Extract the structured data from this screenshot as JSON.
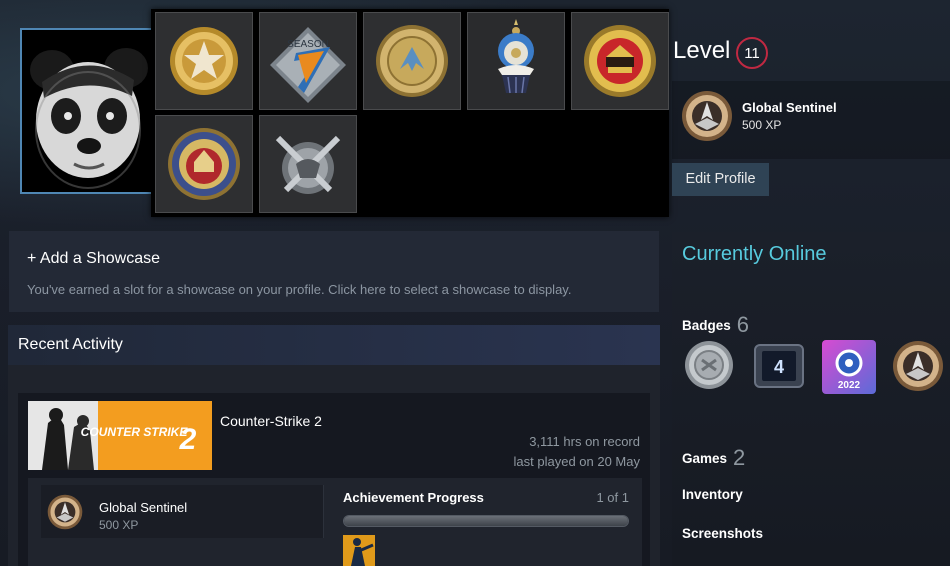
{
  "profile": {
    "level_label": "Level",
    "level": "11",
    "favorite_badge": {
      "name": "Global Sentinel",
      "xp": "500 XP",
      "icon": "cs-rank-badge-icon"
    },
    "edit_profile_label": "Edit Profile",
    "status": "Currently Online"
  },
  "pins_popup": {
    "pins": [
      {
        "name": "service-medal-pin",
        "icon": "gold-star-medal-icon"
      },
      {
        "name": "season-pin",
        "icon": "season-7-pin-icon",
        "text": "SEASON"
      },
      {
        "name": "antwerp-coin-pin",
        "icon": "gold-coin-icon"
      },
      {
        "name": "cupcake-pin",
        "icon": "cupcake-icon"
      },
      {
        "name": "major-coin-pin",
        "icon": "gold-red-coin-icon"
      },
      {
        "name": "stockholm-coin-pin",
        "icon": "stockholm-coin-icon"
      },
      {
        "name": "silver-weapons-pin",
        "icon": "silver-emblem-icon"
      }
    ]
  },
  "sidebar": {
    "badges_label": "Badges",
    "badges_count": "6",
    "badges": [
      {
        "name": "badge-silver-coin",
        "icon": "silver-coin-icon"
      },
      {
        "name": "badge-years-of-service",
        "icon": "years-service-icon",
        "text": "4"
      },
      {
        "name": "badge-steam-2022",
        "icon": "steam-2022-icon",
        "text": "2022"
      },
      {
        "name": "badge-cs-rank",
        "icon": "cs-rank-badge-icon"
      }
    ],
    "games_label": "Games",
    "games_count": "2",
    "inventory_label": "Inventory",
    "screenshots_label": "Screenshots"
  },
  "showcase": {
    "title": "+ Add a Showcase",
    "description": "You've earned a slot for a showcase on your profile. Click here to select a showcase to display."
  },
  "recent_activity": {
    "title": "Recent Activity",
    "game": {
      "name": "Counter-Strike 2",
      "capsule_text": "COUNTER STRIKE",
      "capsule_number": "2",
      "hours": "3,111 hrs on record",
      "last_played": "last played on 20 May",
      "badge_name": "Global Sentinel",
      "badge_xp": "500 XP",
      "achievement_label": "Achievement Progress",
      "achievement_count": "1 of 1",
      "achievement_progress": 1.0
    }
  },
  "colors": {
    "accent_online": "#57cbde",
    "level_ring": "#c02942",
    "avatar_border": "#4f87b4",
    "capsule_orange": "#f39d1f"
  }
}
